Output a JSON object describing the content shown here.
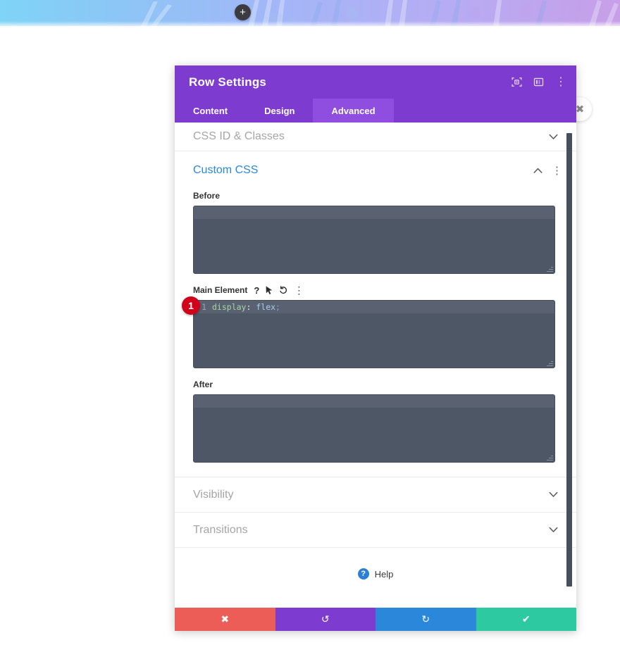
{
  "banner": {
    "add_section_button_label": "+",
    "add_section_icon": "plus-icon"
  },
  "floating": {
    "close_icon": "close-circle-icon",
    "close_glyph": "✖"
  },
  "modal": {
    "title": "Row Settings",
    "header_icons": [
      {
        "name": "focus-target-icon",
        "label": ""
      },
      {
        "name": "layout-columns-icon",
        "label": ""
      },
      {
        "name": "vertical-dots-icon",
        "label": "⋮"
      }
    ],
    "tabs": [
      {
        "label": "Content",
        "active": false
      },
      {
        "label": "Design",
        "active": false
      },
      {
        "label": "Advanced",
        "active": true
      }
    ],
    "sections": {
      "css_id_classes": {
        "label": "CSS ID & Classes",
        "chevron": "⌄",
        "expanded": false
      },
      "custom_css": {
        "label": "Custom CSS",
        "chevron": "⌃",
        "expanded": true,
        "options_icon": "⋮",
        "fields": [
          {
            "label": "Before",
            "value": "",
            "icons": [],
            "name": "before"
          },
          {
            "label": "Main Element",
            "value": "display: flex;",
            "line_number": "1",
            "code_tokens": {
              "property": "display",
              "colon": ":",
              "value": "flex",
              "semicolon": ";"
            },
            "icons": [
              {
                "name": "help-question-icon",
                "glyph": "?"
              },
              {
                "name": "cursor-pointer-icon",
                "glyph": "⯈"
              },
              {
                "name": "reset-undo-icon",
                "glyph": "↺"
              },
              {
                "name": "vertical-dots-icon",
                "glyph": "⋮"
              }
            ],
            "name": "main-element"
          },
          {
            "label": "After",
            "value": "",
            "icons": [],
            "name": "after"
          }
        ]
      },
      "visibility": {
        "label": "Visibility",
        "chevron": "⌄",
        "expanded": false
      },
      "transitions": {
        "label": "Transitions",
        "chevron": "⌄",
        "expanded": false
      }
    },
    "help": {
      "label": "Help",
      "icon_glyph": "?",
      "icon_name": "help-circle-icon"
    },
    "footer_buttons": [
      {
        "name": "cancel-button",
        "glyph": "✖",
        "color": "#eb5d56"
      },
      {
        "name": "undo-button",
        "glyph": "↺",
        "color": "#7e3bd0"
      },
      {
        "name": "redo-button",
        "glyph": "↻",
        "color": "#2b87da"
      },
      {
        "name": "save-button",
        "glyph": "✔",
        "color": "#2dc9a0"
      }
    ]
  },
  "annotation": {
    "badge_number": "1"
  },
  "colors": {
    "purple": "#7e3bd0",
    "purple_active_tab": "#8f4ee0",
    "blue_link": "#2b87da",
    "code_bg": "#4e5766",
    "red": "#eb5d56",
    "teal": "#2dc9a0",
    "badge_red": "#d0021b"
  }
}
